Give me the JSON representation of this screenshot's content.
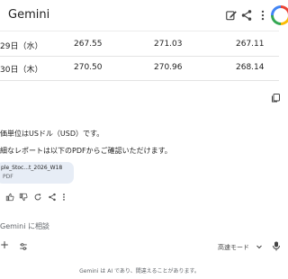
{
  "header": {
    "title": "Gemini"
  },
  "table": {
    "rows": [
      {
        "date": "29日（水）",
        "c1": "267.55",
        "c2": "271.03",
        "c3": "267.11"
      },
      {
        "date": "30日（木）",
        "c1": "270.50",
        "c2": "270.96",
        "c3": "268.14"
      }
    ]
  },
  "message": {
    "line1": "価単位はUSドル（USD）です。",
    "line2": "細なレポートは以下のPDFからご確認いただけます。"
  },
  "file": {
    "name": "ple_Stoc...t_2026_W18",
    "type": "PDF"
  },
  "input": {
    "placeholder": "Gemini に相談",
    "mode_label": "高速モード"
  },
  "footer": {
    "disclaimer": "Gemini は AI であり、間違えることがあります。"
  },
  "icons": [
    "edit-icon",
    "share-icon",
    "more-vert-icon",
    "copy-icon",
    "thumb-up-icon",
    "thumb-down-icon",
    "regenerate-icon",
    "share-small-icon",
    "more-vert-small-icon",
    "plus-icon",
    "tune-icon",
    "chevron-down-icon",
    "mic-icon"
  ],
  "colors": {
    "background": "#ffffff",
    "file_card": "#e7edf6",
    "divider": "#e3e3e3",
    "text": "#1f1f1f",
    "muted": "#5f6368"
  }
}
